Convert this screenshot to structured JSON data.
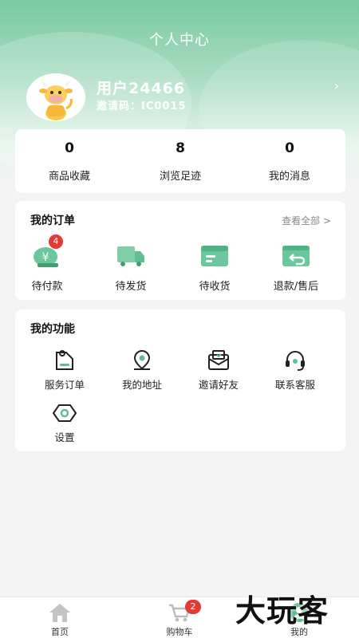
{
  "header": {
    "title": "个人中心"
  },
  "profile": {
    "name": "用户24466",
    "invite_code": "邀请码：IC0015"
  },
  "stats": [
    {
      "value": "0",
      "label": "商品收藏"
    },
    {
      "value": "8",
      "label": "浏览足迹"
    },
    {
      "value": "0",
      "label": "我的消息"
    }
  ],
  "orders": {
    "title": "我的订单",
    "view_all": "查看全部 >",
    "items": [
      {
        "label": "待付款",
        "badge": "4",
        "icon": "payment-icon"
      },
      {
        "label": "待发货",
        "icon": "truck-icon"
      },
      {
        "label": "待收货",
        "icon": "package-icon"
      },
      {
        "label": "退款/售后",
        "icon": "refund-icon"
      }
    ]
  },
  "functions": {
    "title": "我的功能",
    "items": [
      {
        "label": "服务订单",
        "icon": "service-order-icon"
      },
      {
        "label": "我的地址",
        "icon": "location-icon"
      },
      {
        "label": "邀请好友",
        "icon": "invite-envelope-icon"
      },
      {
        "label": "联系客服",
        "icon": "headset-icon"
      },
      {
        "label": "设置",
        "icon": "settings-icon"
      }
    ]
  },
  "tabbar": [
    {
      "label": "首页",
      "icon": "home-icon"
    },
    {
      "label": "购物车",
      "icon": "cart-icon",
      "badge": "2"
    },
    {
      "label": "我的",
      "icon": "profile-icon"
    }
  ],
  "watermark": "大玩客",
  "colors": {
    "accent": "#5fbf93",
    "badge": "#e53935",
    "header_gradient_top": "#78c9a1"
  }
}
